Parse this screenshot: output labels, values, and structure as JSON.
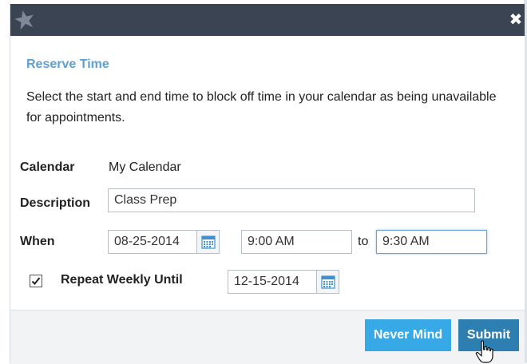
{
  "dialog": {
    "title": "Reserve Time",
    "description": "Select the start and end time to block off time in your calendar as being unavailable for appointments.",
    "close_icon": "close-icon"
  },
  "form": {
    "calendar_label": "Calendar",
    "calendar_value": "My Calendar",
    "description_label": "Description",
    "description_value": "Class Prep",
    "when_label": "When",
    "start_date": "08-25-2014",
    "start_time": "9:00 AM",
    "to_label": "to",
    "end_time": "9:30 AM",
    "repeat_label": "Repeat Weekly Until",
    "repeat_checked": true,
    "repeat_until": "12-15-2014"
  },
  "footer": {
    "never_mind_label": "Never Mind",
    "submit_label": "Submit"
  },
  "colors": {
    "titlebar": "#3b4452",
    "heading": "#5ea0d4",
    "never_mind": "#36a9e6",
    "submit": "#2e7fb1"
  },
  "icons": [
    "logo-star-icon",
    "close-icon",
    "calendar-icon",
    "checkmark-icon",
    "hand-cursor-icon"
  ]
}
